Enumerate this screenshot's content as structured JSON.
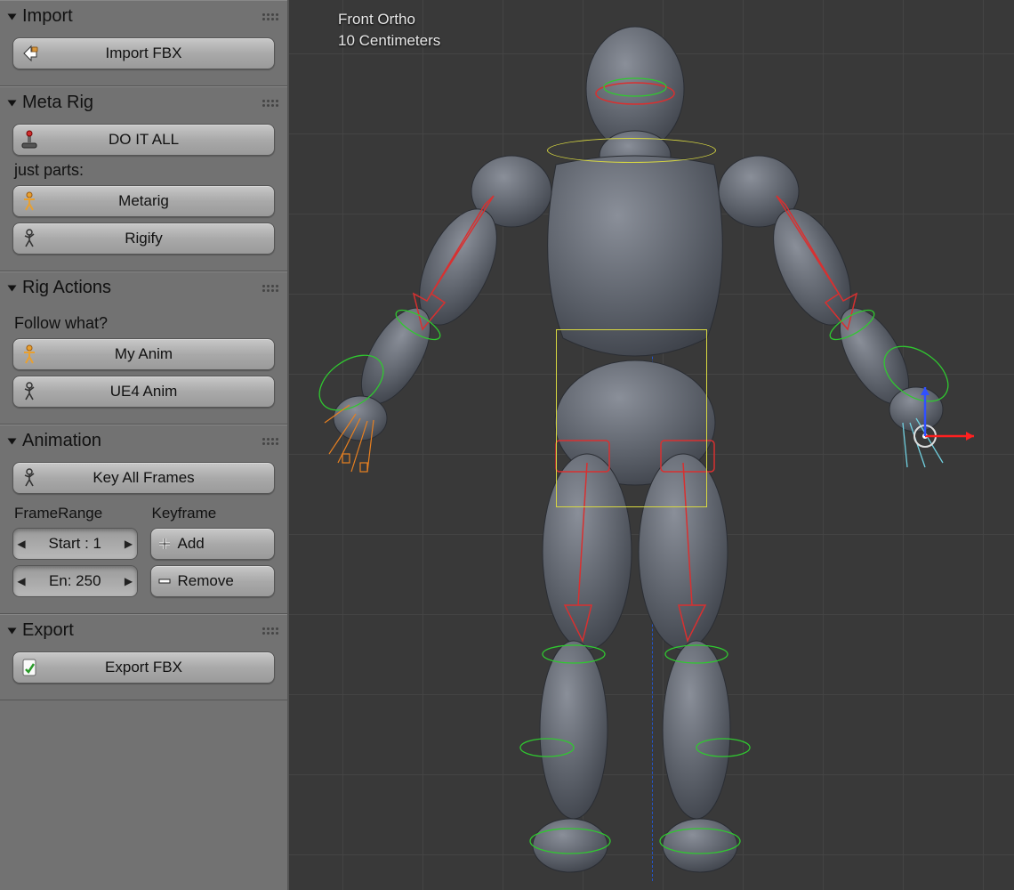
{
  "viewport": {
    "view_label": "Front Ortho",
    "scale_label": "10 Centimeters"
  },
  "panels": {
    "import": {
      "title": "Import",
      "import_fbx": "Import FBX"
    },
    "meta_rig": {
      "title": "Meta Rig",
      "do_it_all": "DO IT ALL",
      "just_parts_label": "just parts:",
      "metarig": "Metarig",
      "rigify": "Rigify"
    },
    "rig_actions": {
      "title": "Rig Actions",
      "follow_label": "Follow what?",
      "my_anim": "My Anim",
      "ue4_anim": "UE4 Anim"
    },
    "animation": {
      "title": "Animation",
      "key_all": "Key All Frames",
      "framerange_label": "FrameRange",
      "keyframe_label": "Keyframe",
      "start_field": "Start : 1",
      "end_field": "En:  250",
      "add": "Add",
      "remove": "Remove"
    },
    "export": {
      "title": "Export",
      "export_fbx": "Export FBX"
    }
  }
}
